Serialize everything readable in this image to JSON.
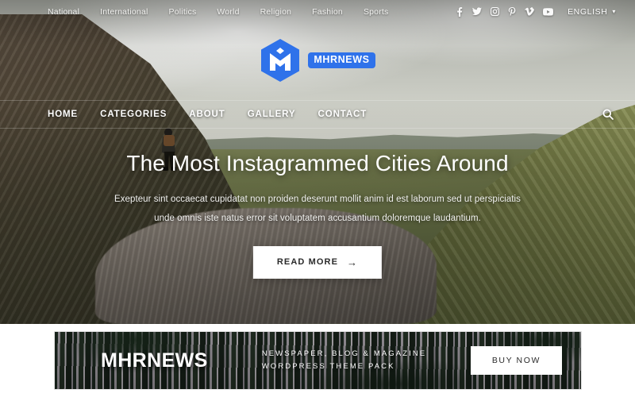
{
  "topbar": {
    "categories": [
      {
        "label": "National"
      },
      {
        "label": "International"
      },
      {
        "label": "Politics"
      },
      {
        "label": "World"
      },
      {
        "label": "Religion"
      },
      {
        "label": "Fashion"
      },
      {
        "label": "Sports"
      }
    ],
    "socials": [
      {
        "name": "facebook-icon"
      },
      {
        "name": "twitter-icon"
      },
      {
        "name": "instagram-icon"
      },
      {
        "name": "pinterest-icon"
      },
      {
        "name": "vimeo-icon"
      },
      {
        "name": "youtube-icon"
      }
    ],
    "language": "ENGLISH",
    "language_caret": "▾"
  },
  "logo": {
    "mark": "hexagon-m-logo",
    "badge_text": "MHRNEWS",
    "brand_color": "#2f72ea"
  },
  "mainnav": {
    "items": [
      {
        "label": "HOME"
      },
      {
        "label": "CATEGORIES"
      },
      {
        "label": "ABOUT"
      },
      {
        "label": "GALLERY"
      },
      {
        "label": "CONTACT"
      }
    ],
    "search_icon": "search-icon"
  },
  "hero": {
    "title": "The Most Instagrammed Cities Around",
    "subtitle": "Exepteur sint occaecat cupidatat non proiden deserunt mollit anim id est laborum sed ut perspiciatis unde omnis iste natus error sit voluptatem accusantium doloremque laudantium.",
    "cta_label": "READ MORE",
    "cta_arrow": "→",
    "image": "mountain-valley-hiker-photo"
  },
  "promo": {
    "brand": "MHRNEWS",
    "line1": "NEWSPAPER, BLOG & MAGAZINE",
    "line2": "WORDPRESS THEME PACK",
    "button_label": "BUY NOW",
    "image": "forest-trees-photo"
  }
}
